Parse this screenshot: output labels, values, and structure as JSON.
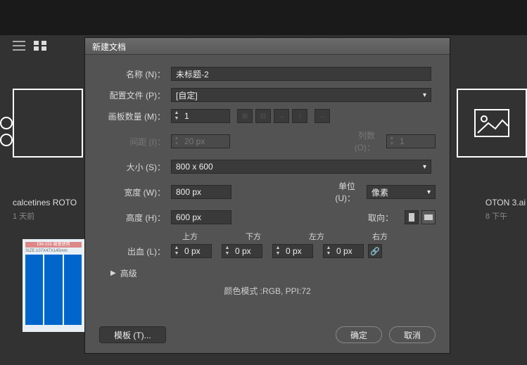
{
  "background": {
    "files": {
      "left": {
        "name": "calcetines ROTO",
        "time": "1 天前"
      },
      "right": {
        "name": "OTON 3.ai",
        "time": "8 下午"
      }
    },
    "thumb": {
      "header": "DM-155 扁盒使用",
      "size": "SIZE:107X47X145mm"
    }
  },
  "dialog": {
    "title": "新建文档",
    "labels": {
      "name": "名称 (N)：",
      "profile": "配置文件 (P)：",
      "artboards": "画板数量 (M)：",
      "spacing": "间距 (I)：",
      "columns": "列数 (O)：",
      "size": "大小 (S)：",
      "width": "宽度 (W)：",
      "height": "高度 (H)：",
      "units": "单位 (U)：",
      "orientation": "取向：",
      "bleed": "出血 (L)：",
      "advanced": "高级",
      "color_mode": "颜色模式 :RGB, PPI:72"
    },
    "values": {
      "name": "未标题-2",
      "profile": "[自定]",
      "artboards": "1",
      "spacing": "20 px",
      "columns": "1",
      "size": "800 x 600",
      "width": "800 px",
      "height": "600 px",
      "units": "像素",
      "bleed_top": "0 px",
      "bleed_bottom": "0 px",
      "bleed_left": "0 px",
      "bleed_right": "0 px"
    },
    "bleed_headers": {
      "top": "上方",
      "bottom": "下方",
      "left": "左方",
      "right": "右方"
    },
    "buttons": {
      "template": "模板 (T)...",
      "ok": "确定",
      "cancel": "取消"
    }
  }
}
